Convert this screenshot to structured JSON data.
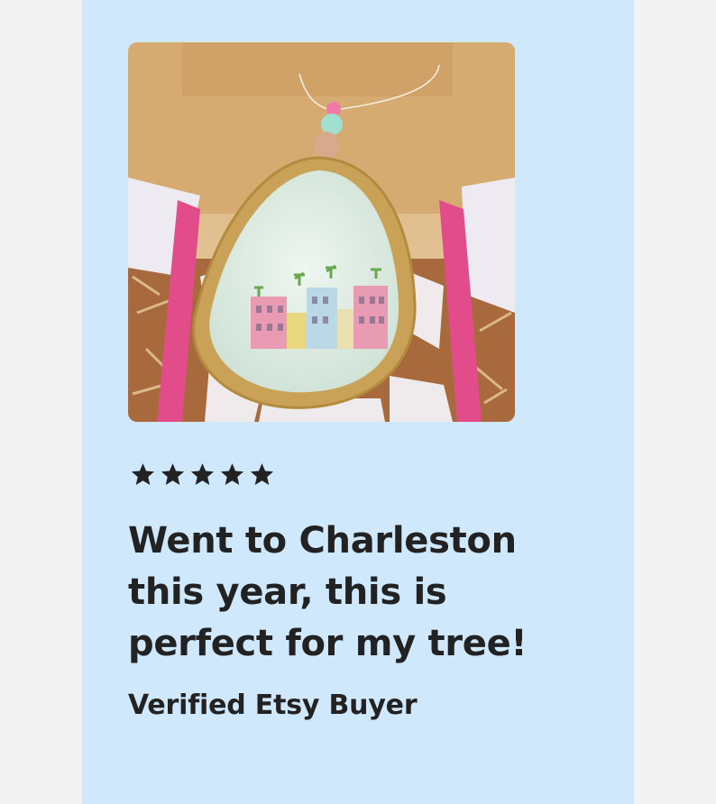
{
  "review": {
    "rating": 5,
    "rating_max": 5,
    "star_icon": "star-icon",
    "text": "Went to Charleston this year, this is perfect for my tree!",
    "reviewer": "Verified Etsy Buyer"
  },
  "photo": {
    "subject": "oyster-shell-ornament-photo"
  },
  "colors": {
    "page_bg": "#f2f2f2",
    "card_bg": "#cfe8fc",
    "text": "#222222",
    "star": "#222222"
  }
}
